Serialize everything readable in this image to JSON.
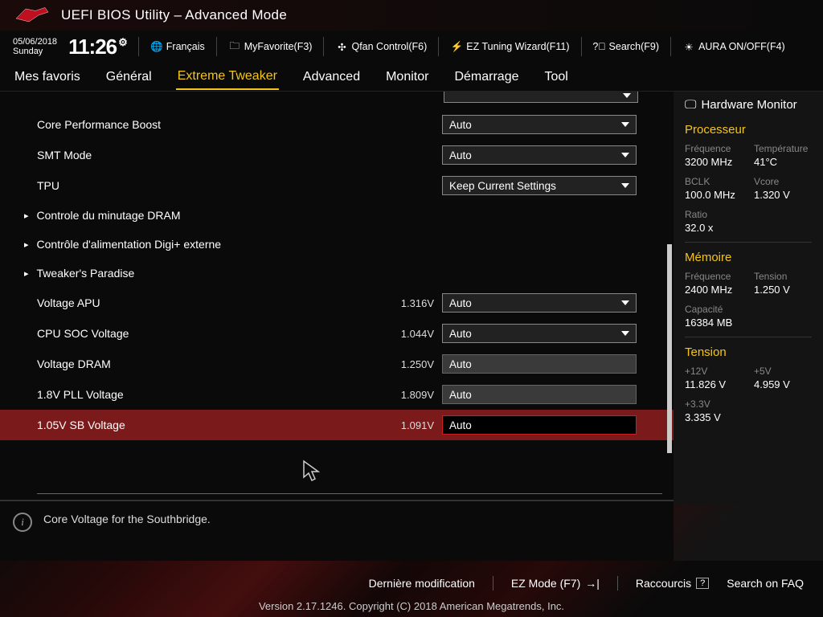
{
  "header": {
    "title": "UEFI BIOS Utility – Advanced Mode"
  },
  "topbar": {
    "date": "05/06/2018",
    "day": "Sunday",
    "time": "11:26",
    "language": "Français",
    "myfavorite": "MyFavorite(F3)",
    "qfan": "Qfan Control(F6)",
    "eztuning": "EZ Tuning Wizard(F11)",
    "search": "Search(F9)",
    "aura": "AURA ON/OFF(F4)"
  },
  "tabs": [
    "Mes favoris",
    "Général",
    "Extreme Tweaker",
    "Advanced",
    "Monitor",
    "Démarrage",
    "Tool"
  ],
  "settings": {
    "cpb": {
      "label": "Core Performance Boost",
      "value": "Auto"
    },
    "smt": {
      "label": "SMT Mode",
      "value": "Auto"
    },
    "tpu": {
      "label": "TPU",
      "value": "Keep Current Settings"
    },
    "sub1": "Controle du minutage DRAM",
    "sub2": "Contrôle d'alimentation Digi+ externe",
    "sub3": "Tweaker's Paradise",
    "vapu": {
      "label": "Voltage APU",
      "reading": "1.316V",
      "value": "Auto"
    },
    "vsoc": {
      "label": "CPU SOC Voltage",
      "reading": "1.044V",
      "value": "Auto"
    },
    "vdram": {
      "label": "Voltage DRAM",
      "reading": "1.250V",
      "value": "Auto"
    },
    "vpll": {
      "label": "1.8V PLL Voltage",
      "reading": "1.809V",
      "value": "Auto"
    },
    "vsb": {
      "label": "1.05V SB Voltage",
      "reading": "1.091V",
      "value": "Auto"
    }
  },
  "help": "Core Voltage for the Southbridge.",
  "sidebar": {
    "title": "Hardware Monitor",
    "cpu": {
      "title": "Processeur",
      "freq_l": "Fréquence",
      "freq_v": "3200 MHz",
      "temp_l": "Température",
      "temp_v": "41°C",
      "bclk_l": "BCLK",
      "bclk_v": "100.0 MHz",
      "vcore_l": "Vcore",
      "vcore_v": "1.320 V",
      "ratio_l": "Ratio",
      "ratio_v": "32.0 x"
    },
    "mem": {
      "title": "Mémoire",
      "freq_l": "Fréquence",
      "freq_v": "2400 MHz",
      "volt_l": "Tension",
      "volt_v": "1.250 V",
      "cap_l": "Capacité",
      "cap_v": "16384 MB"
    },
    "volt": {
      "title": "Tension",
      "v12_l": "+12V",
      "v12_v": "11.826 V",
      "v5_l": "+5V",
      "v5_v": "4.959 V",
      "v33_l": "+3.3V",
      "v33_v": "3.335 V"
    }
  },
  "footer": {
    "lastmod": "Dernière modification",
    "ezmode": "EZ Mode (F7)",
    "shortcuts": "Raccourcis",
    "faq": "Search on FAQ"
  },
  "version": "Version 2.17.1246. Copyright (C) 2018 American Megatrends, Inc."
}
